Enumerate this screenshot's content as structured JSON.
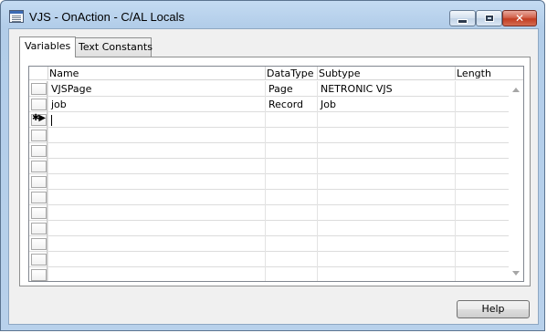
{
  "window": {
    "title": "VJS - OnAction - C/AL Locals"
  },
  "tabs": [
    {
      "label": "Variables",
      "active": true
    },
    {
      "label": "Text Constants",
      "active": false
    }
  ],
  "grid": {
    "columns": [
      "Name",
      "DataType",
      "Subtype",
      "Length"
    ],
    "rows": [
      {
        "name": "VJSPage",
        "datatype": "Page",
        "subtype": "NETRONIC VJS",
        "length": ""
      },
      {
        "name": "job",
        "datatype": "Record",
        "subtype": "Job",
        "length": ""
      }
    ],
    "new_row_marker": "✱▶"
  },
  "buttons": {
    "help": "Help"
  },
  "icons": {
    "window": "cal-locals-window-icon",
    "minimize": "minimize-icon",
    "maximize": "maximize-icon",
    "close": "close-icon"
  },
  "colors": {
    "titlebar": "#b9d3ee",
    "close": "#c94a2e",
    "client": "#f0f0f0"
  }
}
